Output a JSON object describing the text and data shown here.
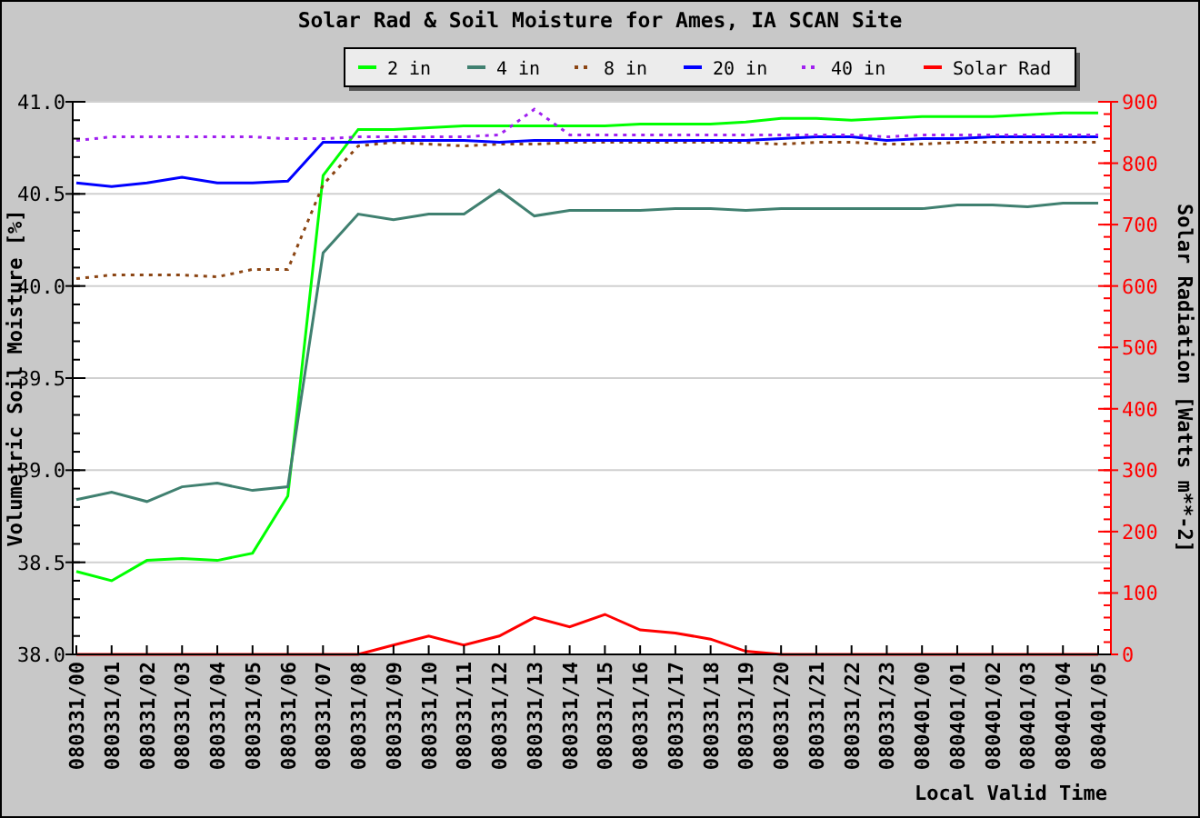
{
  "chart_data": {
    "type": "line",
    "title": "Solar Rad & Soil Moisture for Ames, IA SCAN Site",
    "xlabel": "Local Valid Time",
    "ylabel": "Volumetric Soil Moisture [%]",
    "y2label": "Solar Radiation [Watts m**-2]",
    "grid": true,
    "legend": "top",
    "categories": [
      "080331/00",
      "080331/01",
      "080331/02",
      "080331/03",
      "080331/04",
      "080331/05",
      "080331/06",
      "080331/07",
      "080331/08",
      "080331/09",
      "080331/10",
      "080331/11",
      "080331/12",
      "080331/13",
      "080331/14",
      "080331/15",
      "080331/16",
      "080331/17",
      "080331/18",
      "080331/19",
      "080331/20",
      "080331/21",
      "080331/22",
      "080331/23",
      "080401/00",
      "080401/01",
      "080401/02",
      "080401/03",
      "080401/04",
      "080401/05"
    ],
    "ylim": [
      38,
      41
    ],
    "yticks": [
      {
        "value": 38,
        "label": "38.0"
      },
      {
        "value": 38.5,
        "label": "38.5"
      },
      {
        "value": 39,
        "label": "39.0"
      },
      {
        "value": 39.5,
        "label": "39.5"
      },
      {
        "value": 40,
        "label": "40.0"
      },
      {
        "value": 40.5,
        "label": "40.5"
      },
      {
        "value": 41,
        "label": "41.0"
      }
    ],
    "y2lim": [
      0,
      900
    ],
    "y2ticks": [
      {
        "value": 0,
        "label": "0"
      },
      {
        "value": 100,
        "label": "100"
      },
      {
        "value": 200,
        "label": "200"
      },
      {
        "value": 300,
        "label": "300"
      },
      {
        "value": 400,
        "label": "400"
      },
      {
        "value": 500,
        "label": "500"
      },
      {
        "value": 600,
        "label": "600"
      },
      {
        "value": 700,
        "label": "700"
      },
      {
        "value": 800,
        "label": "800"
      },
      {
        "value": 900,
        "label": "900"
      }
    ],
    "series": [
      {
        "name": "2 in",
        "color": "#00ff00",
        "values": [
          38.45,
          38.4,
          38.51,
          38.52,
          38.51,
          38.55,
          38.86,
          40.6,
          40.85,
          40.85,
          40.86,
          40.87,
          40.87,
          40.87,
          40.87,
          40.87,
          40.88,
          40.88,
          40.88,
          40.89,
          40.91,
          40.91,
          40.9,
          40.91,
          40.92,
          40.92,
          40.92,
          40.93,
          40.94,
          40.94
        ]
      },
      {
        "name": "4 in",
        "color": "#408070",
        "values": [
          38.84,
          38.88,
          38.83,
          38.91,
          38.93,
          38.89,
          38.91,
          40.18,
          40.39,
          40.36,
          40.39,
          40.39,
          40.52,
          40.38,
          40.41,
          40.41,
          40.41,
          40.42,
          40.42,
          40.41,
          40.42,
          40.42,
          40.42,
          40.42,
          40.42,
          40.44,
          40.44,
          40.43,
          40.45,
          40.45
        ]
      },
      {
        "name": "8 in",
        "color": "#8b4513",
        "line_style": "dotted",
        "values": [
          40.04,
          40.06,
          40.06,
          40.06,
          40.05,
          40.09,
          40.09,
          40.55,
          40.76,
          40.78,
          40.77,
          40.76,
          40.77,
          40.77,
          40.78,
          40.78,
          40.78,
          40.78,
          40.78,
          40.78,
          40.77,
          40.78,
          40.78,
          40.77,
          40.77,
          40.78,
          40.78,
          40.78,
          40.78,
          40.78
        ]
      },
      {
        "name": "20 in",
        "color": "#0000ff",
        "values": [
          40.56,
          40.54,
          40.56,
          40.59,
          40.56,
          40.56,
          40.57,
          40.78,
          40.78,
          40.79,
          40.79,
          40.79,
          40.78,
          40.79,
          40.79,
          40.79,
          40.79,
          40.79,
          40.79,
          40.79,
          40.8,
          40.81,
          40.81,
          40.79,
          40.8,
          40.8,
          40.81,
          40.81,
          40.81,
          40.81
        ]
      },
      {
        "name": "40 in",
        "color": "#a020f0",
        "line_style": "dotted",
        "values": [
          40.79,
          40.81,
          40.81,
          40.81,
          40.81,
          40.81,
          40.8,
          40.8,
          40.81,
          40.81,
          40.81,
          40.81,
          40.82,
          40.96,
          40.82,
          40.82,
          40.82,
          40.82,
          40.82,
          40.82,
          40.82,
          40.82,
          40.82,
          40.81,
          40.82,
          40.82,
          40.82,
          40.82,
          40.82,
          40.82
        ]
      },
      {
        "name": "Solar Rad",
        "color": "#ff0000",
        "axis": "y2",
        "values": [
          0,
          0,
          0,
          0,
          0,
          0,
          0,
          0,
          0,
          15,
          30,
          15,
          30,
          60,
          45,
          65,
          40,
          35,
          25,
          5,
          0,
          0,
          0,
          0,
          0,
          0,
          0,
          0,
          0,
          0
        ]
      }
    ]
  }
}
